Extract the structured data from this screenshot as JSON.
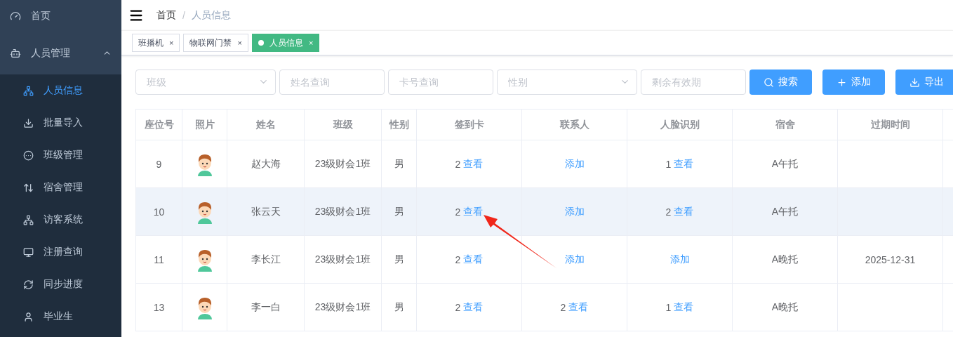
{
  "sidebar": {
    "items": [
      {
        "label": "首页",
        "selected": false
      },
      {
        "label": "人员管理",
        "selected": false,
        "expanded": true,
        "children": [
          {
            "label": "人员信息",
            "selected": true
          },
          {
            "label": "批量导入",
            "selected": false
          },
          {
            "label": "班级管理",
            "selected": false
          },
          {
            "label": "宿舍管理",
            "selected": false
          },
          {
            "label": "访客系统",
            "selected": false
          },
          {
            "label": "注册查询",
            "selected": false
          },
          {
            "label": "同步进度",
            "selected": false
          },
          {
            "label": "毕业生",
            "selected": false
          }
        ]
      }
    ]
  },
  "breadcrumb": [
    {
      "label": "首页"
    },
    {
      "label": "人员信息"
    }
  ],
  "breadcrumb_separator": "/",
  "tags": [
    {
      "label": "班播机",
      "selected": false
    },
    {
      "label": "物联网门禁",
      "selected": false
    },
    {
      "label": "人员信息",
      "selected": true
    }
  ],
  "tag_close": "×",
  "filters": [
    {
      "kind": "select",
      "placeholder": "班级"
    },
    {
      "kind": "input",
      "placeholder": "姓名查询"
    },
    {
      "kind": "input",
      "placeholder": "卡号查询"
    },
    {
      "kind": "select",
      "placeholder": "性别"
    },
    {
      "kind": "input",
      "placeholder": "剩余有效期"
    }
  ],
  "buttons": [
    {
      "kind": "search",
      "label": "搜索"
    },
    {
      "kind": "add",
      "label": "添加"
    },
    {
      "kind": "export",
      "label": "导出"
    }
  ],
  "table": {
    "columns": [
      "座位号",
      "照片",
      "姓名",
      "班级",
      "性别",
      "签到卡",
      "联系人",
      "人脸识别",
      "宿舍",
      "过期时间"
    ],
    "rows": [
      {
        "highlighted": false,
        "seat": "9",
        "name": "赵大海",
        "class": "23级财会1班",
        "gender": "男",
        "card": {
          "count": "2",
          "link": "查看"
        },
        "contact": {
          "link": "添加"
        },
        "face": {
          "count": "1",
          "link": "查看"
        },
        "dorm": "A午托"
      },
      {
        "highlighted": true,
        "seat": "10",
        "name": "张云天",
        "class": "23级财会1班",
        "gender": "男",
        "card": {
          "count": "2",
          "link": "查看"
        },
        "contact": {
          "link": "添加"
        },
        "face": {
          "count": "2",
          "link": "查看"
        },
        "dorm": "A午托"
      },
      {
        "highlighted": false,
        "seat": "11",
        "name": "李长江",
        "class": "23级财会1班",
        "gender": "男",
        "card": {
          "count": "2",
          "link": "查看"
        },
        "contact": {
          "link": "添加"
        },
        "face": {
          "link": "添加"
        },
        "dorm": "A晚托",
        "expires": "2025-12-31"
      },
      {
        "highlighted": false,
        "seat": "13",
        "name": "李一白",
        "class": "23级财会1班",
        "gender": "男",
        "card": {
          "count": "2",
          "link": "查看"
        },
        "contact": {
          "count": "2",
          "link": "查看"
        },
        "face": {
          "count": "1",
          "link": "查看"
        },
        "dorm": "A晚托"
      }
    ]
  }
}
